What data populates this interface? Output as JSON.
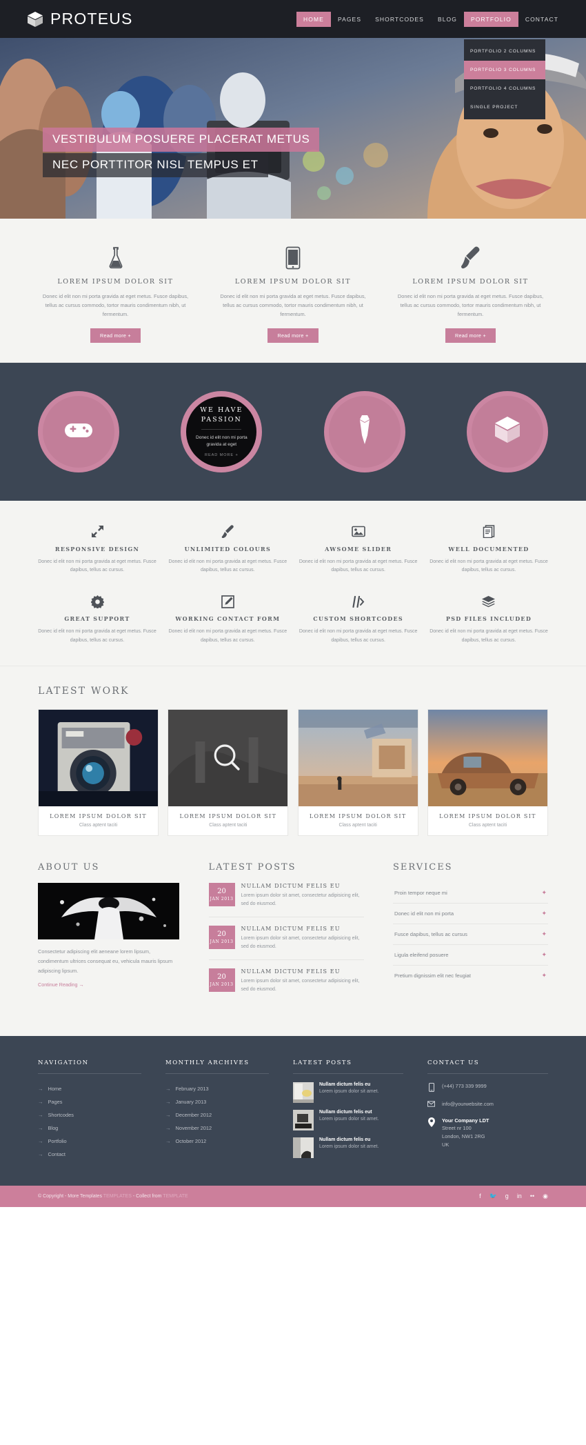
{
  "brand": {
    "name": "PROTEUS",
    "logo_icon": "cube-icon",
    "accent": "#cc7f9b",
    "dark": "#3c4654"
  },
  "nav": {
    "items": [
      {
        "label": "HOME",
        "active": true
      },
      {
        "label": "PAGES",
        "active": false
      },
      {
        "label": "SHORTCODES",
        "active": false
      },
      {
        "label": "BLOG",
        "active": false
      },
      {
        "label": "PORTFOLIO",
        "active": true
      },
      {
        "label": "CONTACT",
        "active": false
      }
    ],
    "dropdown": {
      "owner": "PORTFOLIO",
      "items": [
        {
          "label": "PORTFOLIO 2 COLUMNS",
          "active": false
        },
        {
          "label": "PORTFOLIO 3 COLUMNS",
          "active": true
        },
        {
          "label": "PORTFOLIO 4 COLUMNS",
          "active": false
        },
        {
          "label": "SINGLE PROJECT",
          "active": false
        }
      ]
    }
  },
  "hero": {
    "caption_line1": "VESTIBULUM POSUERE PLACERAT METUS",
    "caption_line2": "NEC PORTTITOR NISL TEMPUS ET"
  },
  "services": {
    "items": [
      {
        "icon": "flask-icon",
        "title": "LOREM IPSUM DOLOR SIT",
        "body": "Donec id elit non mi porta gravida at eget metus. Fusce dapibus, tellus ac cursus commodo, tortor mauris condimentum nibh, ut fermentum.",
        "button": "Read more +"
      },
      {
        "icon": "tablet-icon",
        "title": "LOREM IPSUM DOLOR SIT",
        "body": "Donec id elit non mi porta gravida at eget metus. Fusce dapibus, tellus ac cursus commodo, tortor mauris condimentum nibh, ut fermentum.",
        "button": "Read more +"
      },
      {
        "icon": "paintbrush-icon",
        "title": "LOREM IPSUM DOLOR SIT",
        "body": "Donec id elit non mi porta gravida at eget metus. Fusce dapibus, tellus ac cursus commodo, tortor mauris condimentum nibh, ut fermentum.",
        "button": "Read more +"
      }
    ]
  },
  "circles": {
    "items": [
      {
        "type": "icon",
        "icon": "gamepad-icon"
      },
      {
        "type": "feature",
        "title_line1": "WE HAVE",
        "title_line2": "PASSION",
        "body": "Donec id elit non mi porta gravida at eget",
        "more": "READ MORE +"
      },
      {
        "type": "icon",
        "icon": "tie-icon"
      },
      {
        "type": "icon",
        "icon": "cube-icon"
      }
    ]
  },
  "feature_grid": {
    "items": [
      {
        "icon": "expand-arrows-icon",
        "title": "RESPONSIVE DESIGN",
        "body": "Donec id elit non mi porta gravida at eget metus. Fusce dapibus, tellus ac cursus."
      },
      {
        "icon": "brush-icon",
        "title": "UNLIMITED COLOURS",
        "body": "Donec id elit non mi porta gravida at eget metus. Fusce dapibus, tellus ac cursus."
      },
      {
        "icon": "image-icon",
        "title": "AWSOME SLIDER",
        "body": "Donec id elit non mi porta gravida at eget metus. Fusce dapibus, tellus ac cursus."
      },
      {
        "icon": "documents-icon",
        "title": "WELL DOCUMENTED",
        "body": "Donec id elit non mi porta gravida at eget metus. Fusce dapibus, tellus ac cursus."
      },
      {
        "icon": "gear-icon",
        "title": "GREAT SUPPORT",
        "body": "Donec id elit non mi porta gravida at eget metus. Fusce dapibus, tellus ac cursus."
      },
      {
        "icon": "pencil-square-icon",
        "title": "WORKING CONTACT FORM",
        "body": "Donec id elit non mi porta gravida at eget metus. Fusce dapibus, tellus ac cursus."
      },
      {
        "icon": "code-slash-icon",
        "title": "CUSTOM SHORTCODES",
        "body": "Donec id elit non mi porta gravida at eget metus. Fusce dapibus, tellus ac cursus."
      },
      {
        "icon": "layers-icon",
        "title": "PSD FILES INCLUDED",
        "body": "Donec id elit non mi porta gravida at eget metus. Fusce dapibus, tellus ac cursus."
      }
    ]
  },
  "latest_work": {
    "title": "LATEST WORK",
    "items": [
      {
        "thumb": "camera-lens-photo",
        "name": "LOREM IPSUM DOLOR SIT",
        "sub": "Class aptent taciti"
      },
      {
        "thumb": "search-overlay-photo",
        "name": "LOREM IPSUM DOLOR SIT",
        "sub": "Class aptent taciti"
      },
      {
        "thumb": "desert-scene-photo",
        "name": "LOREM IPSUM DOLOR SIT",
        "sub": "Class aptent taciti"
      },
      {
        "thumb": "rusty-car-photo",
        "name": "LOREM IPSUM DOLOR SIT",
        "sub": "Class aptent taciti"
      }
    ]
  },
  "about": {
    "title": "ABOUT US",
    "image": "winged-figure-photo",
    "body": "Consectetur adipiscing elit aeneane lorem lipsum, condimentum ultrices consequat eu, vehicula mauris lipsum adipiscing lipsum.",
    "more": "Continue Reading →"
  },
  "latest_posts": {
    "title": "LATEST POSTS",
    "items": [
      {
        "day": "20",
        "month": "JAN 2013",
        "title": "NULLAM DICTUM FELIS EU",
        "body": "Lorem ipsum dolor sit amet, consectetur adipisicing elit, sed do eiusmod."
      },
      {
        "day": "20",
        "month": "JAN 2013",
        "title": "NULLAM DICTUM FELIS EU",
        "body": "Lorem ipsum dolor sit amet, consectetur adipisicing elit, sed do eiusmod."
      },
      {
        "day": "20",
        "month": "JAN 2013",
        "title": "NULLAM DICTUM FELIS EU",
        "body": "Lorem ipsum dolor sit amet, consectetur adipisicing elit, sed do eiusmod."
      }
    ]
  },
  "services_list": {
    "title": "SERVICES",
    "items": [
      {
        "label": "Proin tempor neque mi"
      },
      {
        "label": "Donec id elit non mi porta"
      },
      {
        "label": "Fusce dapibus, tellus ac cursus"
      },
      {
        "label": "Ligula eleifend posuere"
      },
      {
        "label": "Pretium dignissim elit nec feugiat"
      }
    ]
  },
  "footer": {
    "navigation": {
      "title": "NAVIGATION",
      "items": [
        "Home",
        "Pages",
        "Shortcodes",
        "Blog",
        "Portfolio",
        "Contact"
      ]
    },
    "archives": {
      "title": "MONTHLY ARCHIVES",
      "items": [
        "February 2013",
        "January 2013",
        "December 2012",
        "November 2012",
        "October 2012"
      ]
    },
    "posts": {
      "title": "LATEST POSTS",
      "items": [
        {
          "title": "Nullam dictum felis eu",
          "body": "Lorem ipsum dolor sit amet."
        },
        {
          "title": "Nullam dictum felis eut",
          "body": "Lorem ipsum dolor sit amet."
        },
        {
          "title": "Nullam dictum felis eu",
          "body": "Lorem ipsum dolor sit amet."
        }
      ]
    },
    "contact": {
      "title": "CONTACT US",
      "phone": "(+44) 773 339 9999",
      "email": "info@yourwebsite.com",
      "company": "Your Company LDT",
      "street": "Street nr 100",
      "city": "London, NW1 2RG",
      "country": "UK"
    },
    "copyright_prefix": "© Copyright - More Templates",
    "copyright_link1": "TEMPLATES",
    "copyright_mid": "- Collect from",
    "copyright_link2": "TEMPLATE",
    "socials": [
      "facebook-icon",
      "twitter-icon",
      "google-plus-icon",
      "linkedin-icon",
      "flickr-icon",
      "dribbble-icon"
    ]
  }
}
